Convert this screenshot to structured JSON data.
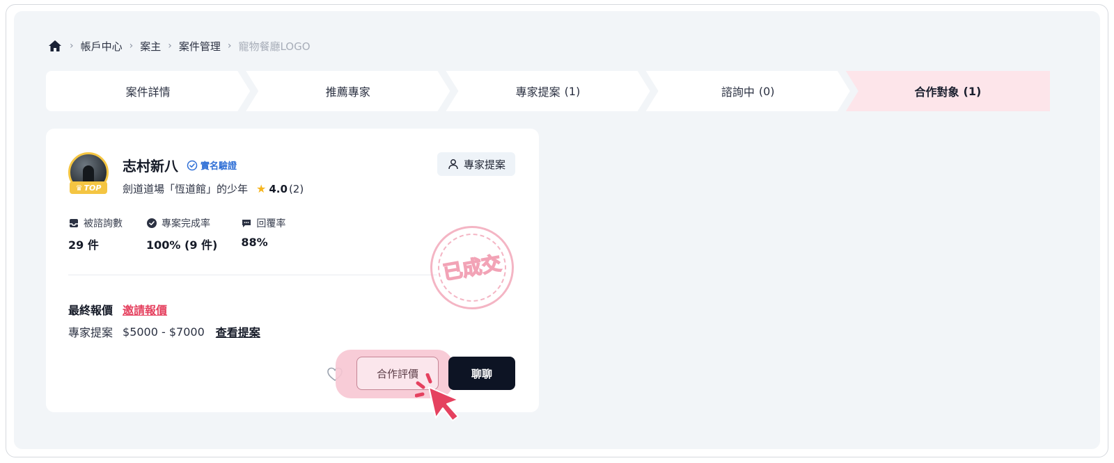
{
  "breadcrumb": {
    "home_icon": "home-icon",
    "items": [
      "帳戶中心",
      "案主",
      "案件管理",
      "寵物餐廳LOGO"
    ]
  },
  "steps": [
    {
      "label": "案件詳情",
      "count": ""
    },
    {
      "label": "推薦專家",
      "count": ""
    },
    {
      "label": "專家提案",
      "count": "(1)"
    },
    {
      "label": "諮詢中",
      "count": "(0)"
    },
    {
      "label": "合作對象",
      "count": "(1)"
    }
  ],
  "expert": {
    "name": "志村新八",
    "verified_label": "實名驗證",
    "badge": "TOP",
    "subtitle": "劍道道場「恆道館」的少年",
    "rating": "4.0",
    "rating_count": "(2)",
    "proposal_button": "專家提案"
  },
  "stats": [
    {
      "icon": "inbox-icon",
      "label": "被諮詢數",
      "value": "29 件"
    },
    {
      "icon": "check-circle-icon",
      "label": "專案完成率",
      "value": "100% (9 件)"
    },
    {
      "icon": "chat-icon",
      "label": "回覆率",
      "value": "88%"
    }
  ],
  "stamp": {
    "text": "已成交"
  },
  "quote": {
    "final_label": "最終報價",
    "invite_link": "邀請報價",
    "proposal_label": "專家提案",
    "price_range": "$5000 - $7000",
    "view_link": "查看提案"
  },
  "actions": {
    "review_button": "合作評價",
    "chat_button": "聊聊"
  },
  "colors": {
    "accent_pink": "#fde5ea",
    "link_red": "#e5415f",
    "verify_blue": "#2f6fd6",
    "dark_button": "#0d1424",
    "star": "#f6b51e"
  }
}
